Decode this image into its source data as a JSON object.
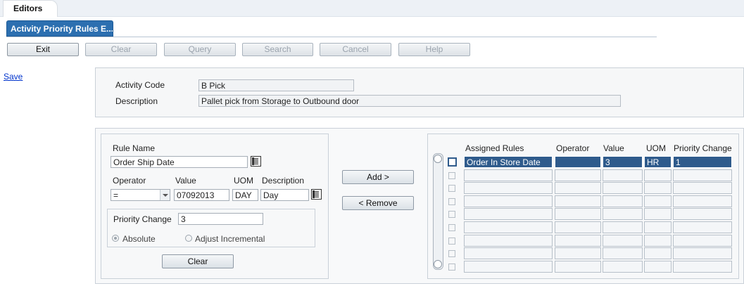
{
  "window": {
    "tab_label": "Editors",
    "document_tab": "Activity Priority Rules E..."
  },
  "toolbar": {
    "exit": "Exit",
    "clear": "Clear",
    "query": "Query",
    "search": "Search",
    "cancel": "Cancel",
    "help": "Help"
  },
  "side": {
    "save_link": "Save"
  },
  "header": {
    "activity_code_label": "Activity Code",
    "activity_code_value": "B Pick",
    "description_label": "Description",
    "description_value": "Pallet pick from Storage to Outbound door"
  },
  "rule_form": {
    "rule_name_label": "Rule Name",
    "rule_name_value": "Order Ship Date",
    "operator_label": "Operator",
    "operator_value": "=",
    "value_label": "Value",
    "value_value": "07092013",
    "uom_label": "UOM",
    "uom_value": "DAY",
    "description_label": "Description",
    "description_value": "Day",
    "priority_change_label": "Priority Change",
    "priority_change_value": "3",
    "absolute_label": "Absolute",
    "adjust_label": "Adjust Incremental",
    "clear_button": "Clear"
  },
  "middle": {
    "add_button": "Add >",
    "remove_button": "< Remove"
  },
  "assigned": {
    "columns": [
      "Assigned Rules",
      "Operator",
      "Value",
      "UOM",
      "Priority Change"
    ],
    "rows": [
      {
        "rule": "Order In Store Date",
        "operator": "",
        "value": "3",
        "uom": "HR",
        "priority": "1"
      }
    ]
  }
}
